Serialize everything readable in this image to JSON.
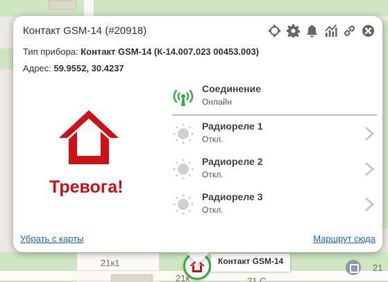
{
  "map": {
    "labels": [
      "21к1",
      "21к",
      "21",
      "21 С"
    ]
  },
  "popup": {
    "title": "Контакт GSM-14 (#20918)",
    "toolbar": [
      "move-icon",
      "gear-icon",
      "bell-icon",
      "chart-icon",
      "link-icon",
      "close-icon"
    ],
    "device_type_label": "Тип прибора: ",
    "device_type_value": "Контакт GSM-14 (К-14.007.023 00453.003)",
    "address_label": "Адрес: ",
    "address_value": "59.9552, 30.4237",
    "alarm_text": "Тревога!",
    "connection": {
      "name": "Соединение",
      "value": "Онлайн"
    },
    "relays": [
      {
        "name": "Радиореле 1",
        "value": "Откл."
      },
      {
        "name": "Радиореле 2",
        "value": "Откл."
      },
      {
        "name": "Радиореле 3",
        "value": "Откл."
      }
    ],
    "remove_link": "Убрать с карты",
    "route_link": "Маршрут сюда"
  },
  "marker": {
    "label": "Контакт GSM-14"
  },
  "colors": {
    "alarm": "#d40f14",
    "online": "#3cae3c",
    "link": "#1a66c8"
  }
}
